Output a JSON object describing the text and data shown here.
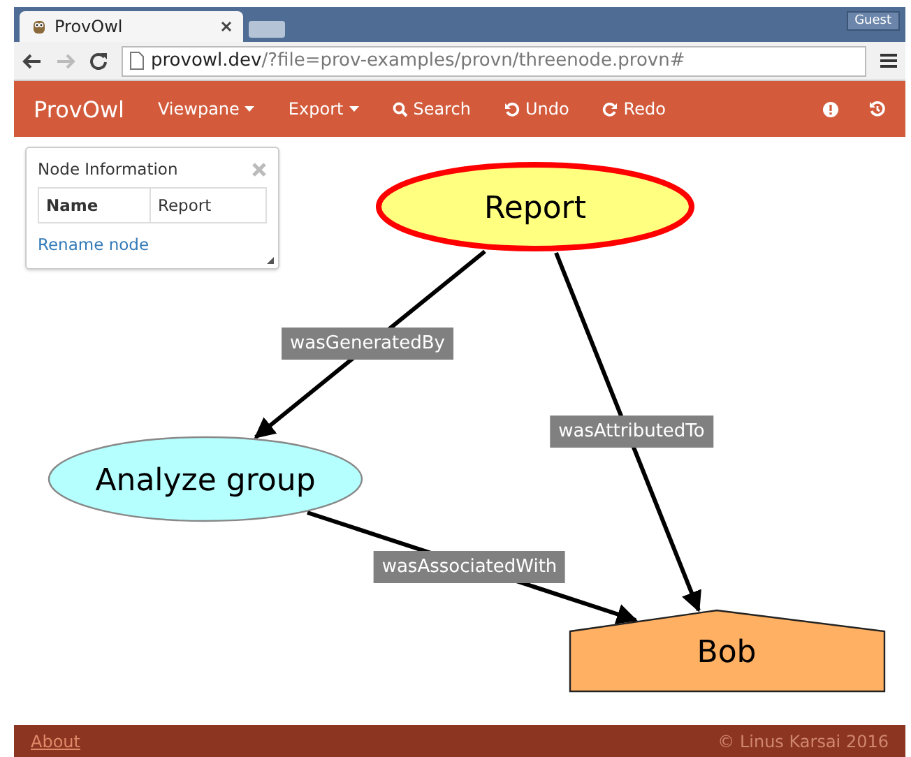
{
  "browser": {
    "tab_title": "ProvOwl",
    "profile": "Guest",
    "url_host": "provowl.dev",
    "url_path": "/?file=prov-examples/provn/threenode.provn#"
  },
  "navbar": {
    "brand": "ProvOwl",
    "items": [
      {
        "label": "Viewpane",
        "kind": "dropdown"
      },
      {
        "label": "Export",
        "kind": "dropdown"
      },
      {
        "label": "Search",
        "kind": "search"
      },
      {
        "label": "Undo",
        "kind": "undo"
      },
      {
        "label": "Redo",
        "kind": "redo"
      }
    ]
  },
  "node_info": {
    "title": "Node Information",
    "field": "Name",
    "value": "Report",
    "link": "Rename node"
  },
  "graph": {
    "nodes": [
      {
        "label": "Report",
        "kind": "entity",
        "selected": true
      },
      {
        "label": "Analyze group",
        "kind": "activity",
        "selected": false
      },
      {
        "label": "Bob",
        "kind": "agent",
        "selected": false
      }
    ],
    "edges": [
      {
        "label": "wasGeneratedBy"
      },
      {
        "label": "wasAttributedTo"
      },
      {
        "label": "wasAssociatedWith"
      }
    ]
  },
  "footer": {
    "link": "About",
    "copyright": "© Linus Karsai 2016"
  }
}
